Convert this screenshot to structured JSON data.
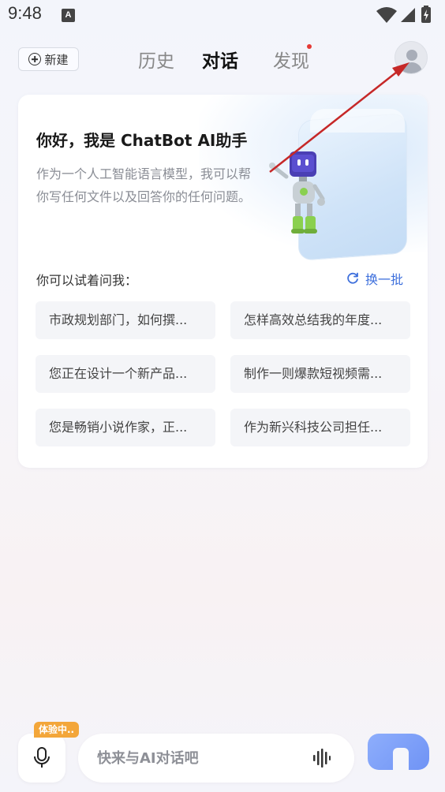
{
  "status_bar": {
    "time": "9:48",
    "notification_icon_letter": "A",
    "icons": [
      "wifi-icon",
      "signal-icon",
      "battery-charging-icon"
    ]
  },
  "header": {
    "new_button_label": "新建",
    "tabs": [
      {
        "label": "历史",
        "active": false
      },
      {
        "label": "对话",
        "active": true
      },
      {
        "label": "发现",
        "active": false,
        "badge_dot": true
      }
    ],
    "avatar_icon": "user-avatar-icon"
  },
  "welcome_card": {
    "greeting": "你好，我是 ChatBot AI助手",
    "intro": "作为一个人工智能语言模型，我可以帮你写任何文件以及回答你的任何问题。",
    "try_label": "你可以试着问我：",
    "refresh_label": "换一批",
    "suggestions": [
      "市政规划部门，如何撰...",
      "怎样高效总结我的年度...",
      "您正在设计一个新产品...",
      "制作一则爆款短视频需...",
      "您是畅销小说作家，正...",
      "作为新兴科技公司担任..."
    ]
  },
  "bottom_bar": {
    "trial_badge": "体验中..",
    "input_placeholder": "快来与AI对话吧",
    "mic_icon": "microphone-icon",
    "voice_wave_icon": "voice-wave-icon"
  },
  "colors": {
    "accent": "#3d6fdc",
    "badge": "#f3a63a",
    "annotation_arrow": "#c62828",
    "send_button": "#7c9cf7"
  }
}
